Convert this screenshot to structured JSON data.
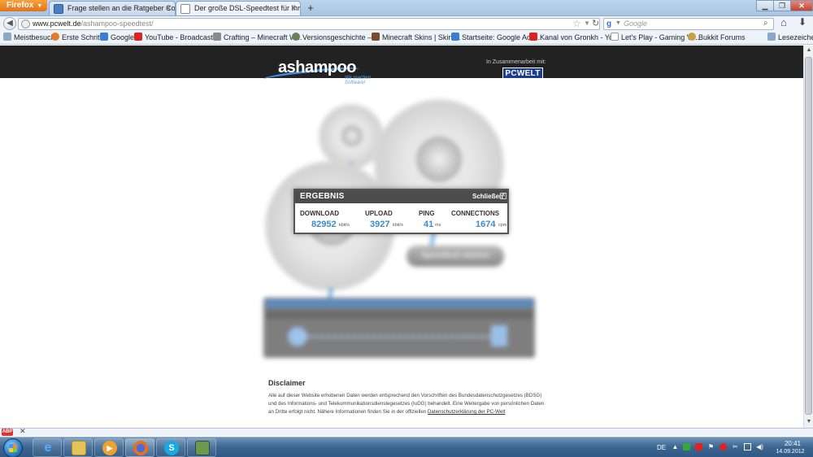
{
  "browser": {
    "app_button": "Firefox",
    "tabs": [
      {
        "label": "Frage stellen an die Ratgeber Commu..."
      },
      {
        "label": "Der große DSL-Speedtest für Ihren DS..."
      }
    ],
    "url_domain": "www.pcwelt.de",
    "url_path": "/ashampoo-speedtest/",
    "search_engine": "Google",
    "search_placeholder": "Google",
    "bookmarks": [
      {
        "label": "Meistbesucht",
        "icon": "bookmark-folder-icon"
      },
      {
        "label": "Erste Schritte",
        "icon": "firefox-icon"
      },
      {
        "label": "Google",
        "icon": "google-icon"
      },
      {
        "label": "YouTube - Broadcast ...",
        "icon": "youtube-icon"
      },
      {
        "label": "Crafting – Minecraft W...",
        "icon": "wiki-icon"
      },
      {
        "label": "Versionsgeschichte – ...",
        "icon": "wiki-icon"
      },
      {
        "label": "Minecraft Skins | Skin ...",
        "icon": "minecraft-icon"
      },
      {
        "label": "Startseite: Google AdS...",
        "icon": "adsense-icon"
      },
      {
        "label": "Kanal von Gronkh - Yo...",
        "icon": "youtube-icon"
      },
      {
        "label": "Let's Play - Gaming Vi...",
        "icon": "page-icon"
      },
      {
        "label": "Bukkit Forums",
        "icon": "bukkit-icon"
      },
      {
        "label": "Lesezeichen",
        "icon": "bookmarks-menu-icon"
      }
    ]
  },
  "page": {
    "logo_text": "ashampoo",
    "logo_tagline": "Wir machen Software!",
    "partner_text": "In Zusammenarbeit mit:",
    "partner_logo": "PCWELT",
    "speedtest_button": "Speedtest starten"
  },
  "result": {
    "title": "ERGEBNIS",
    "close_label": "Schließen",
    "download_label": "DOWNLOAD",
    "download_value": "82952",
    "download_unit": "kbit/s",
    "upload_label": "UPLOAD",
    "upload_value": "3927",
    "upload_unit": "kbit/s",
    "ping_label": "PING",
    "ping_value": "41",
    "ping_unit": "ms",
    "connections_label": "CONNECTIONS",
    "connections_value": "1674",
    "connections_unit": "cpm"
  },
  "disclaimer": {
    "title": "Disclaimer",
    "text": "Alle auf dieser Website erhobenen Daten werden entsprechend den Vorschriften des Bundesdatenschutzgesetzes (BDSG) und des Informations- und Telekommunikationsdienstegesetzes (IuDG) behandelt. Eine Weitergabe von persönlichen Daten an Dritte erfolgt nicht. Nähere Informationen finden Sie in der offiziellen ",
    "link": "Datenschutzerklärung der PC-Welt"
  },
  "taskbar": {
    "language": "DE",
    "time": "20:41",
    "date": "14.09.2012"
  },
  "colors": {
    "result_value": "#3e89d0",
    "header_bg": "#222222",
    "taskbar": "#3c6690"
  }
}
